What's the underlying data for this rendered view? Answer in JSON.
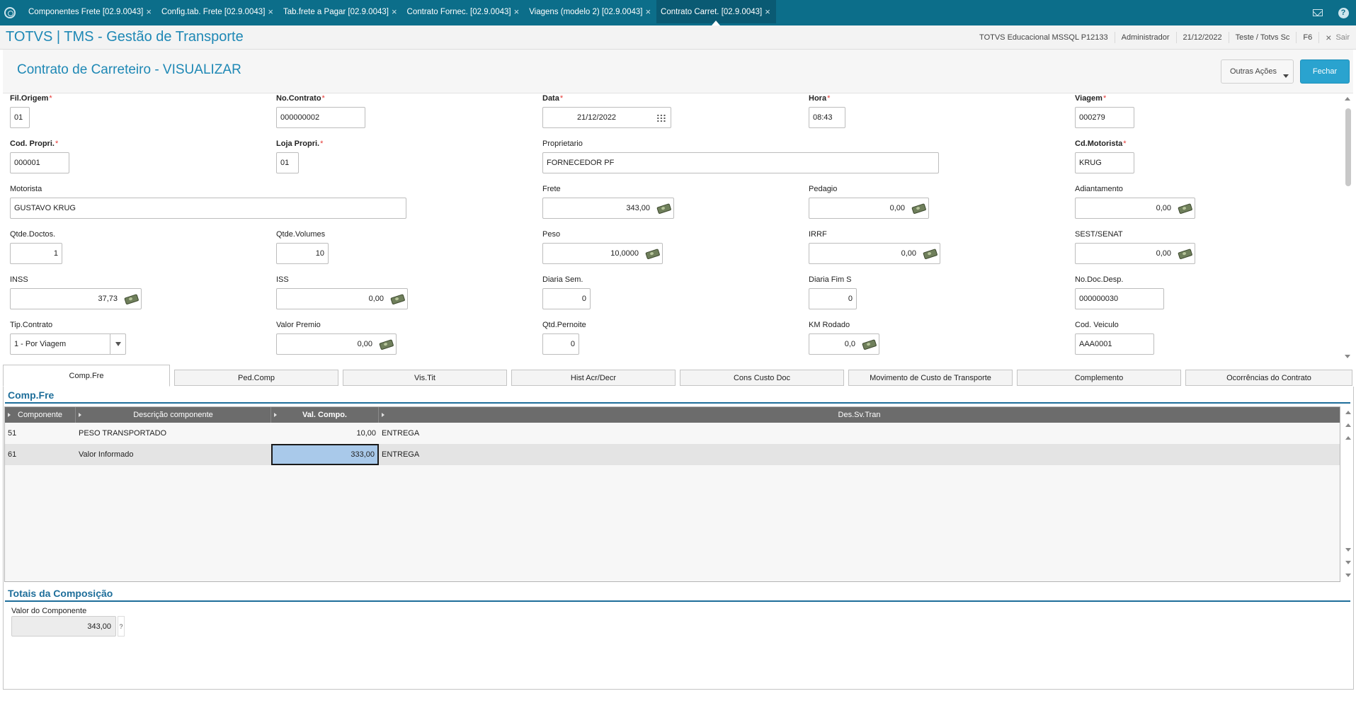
{
  "tabs": [
    {
      "label": "Componentes Frete [02.9.0043]",
      "close": "×",
      "active": false
    },
    {
      "label": "Config.tab. Frete [02.9.0043]",
      "close": "×",
      "active": false
    },
    {
      "label": "Tab.frete a Pagar [02.9.0043]",
      "close": "×",
      "active": false
    },
    {
      "label": "Contrato Fornec. [02.9.0043]",
      "close": "×",
      "active": false
    },
    {
      "label": "Viagens (modelo 2) [02.9.0043]",
      "close": "×",
      "active": false
    },
    {
      "label": "Contrato Carret. [02.9.0043]",
      "close": "×",
      "active": true
    }
  ],
  "header": {
    "app_title": "TOTVS | TMS - Gestão de Transporte",
    "environment": "TOTVS Educacional MSSQL P12133",
    "user": "Administrador",
    "date": "21/12/2022",
    "branch": "Teste / Totvs Sc",
    "shortcut": "F6",
    "exit_label": "Sair",
    "exit_icon": "×"
  },
  "page": {
    "title": "Contrato de Carreteiro - VISUALIZAR",
    "other_actions_label": "Outras Ações",
    "close_label": "Fechar"
  },
  "form": {
    "fil_origem": {
      "label": "Fil.Origem",
      "value": "01",
      "required": "*"
    },
    "no_contrato": {
      "label": "No.Contrato",
      "value": "000000002",
      "required": "*"
    },
    "data": {
      "label": "Data",
      "value": "21/12/2022",
      "required": "*"
    },
    "hora": {
      "label": "Hora",
      "value": "08:43",
      "required": "*"
    },
    "viagem": {
      "label": "Viagem",
      "value": "000279",
      "required": "*"
    },
    "cod_propri": {
      "label": "Cod. Propri.",
      "value": "000001",
      "required": "*"
    },
    "loja_propri": {
      "label": "Loja Propri.",
      "value": "01",
      "required": "*"
    },
    "proprietario": {
      "label": "Proprietario",
      "value": "FORNECEDOR PF"
    },
    "cd_motorista": {
      "label": "Cd.Motorista",
      "value": "KRUG",
      "required": "*"
    },
    "motorista": {
      "label": "Motorista",
      "value": "GUSTAVO KRUG"
    },
    "frete": {
      "label": "Frete",
      "value": "343,00"
    },
    "pedagio": {
      "label": "Pedagio",
      "value": "0,00"
    },
    "adiantamento": {
      "label": "Adiantamento",
      "value": "0,00"
    },
    "qtde_doctos": {
      "label": "Qtde.Doctos.",
      "value": "1"
    },
    "qtde_volumes": {
      "label": "Qtde.Volumes",
      "value": "10"
    },
    "peso": {
      "label": "Peso",
      "value": "10,0000"
    },
    "irrf": {
      "label": "IRRF",
      "value": "0,00"
    },
    "sest_senat": {
      "label": "SEST/SENAT",
      "value": "0,00"
    },
    "inss": {
      "label": "INSS",
      "value": "37,73"
    },
    "iss": {
      "label": "ISS",
      "value": "0,00"
    },
    "diaria_sem": {
      "label": "Diaria Sem.",
      "value": "0"
    },
    "diaria_fim_s": {
      "label": "Diaria Fim S",
      "value": "0"
    },
    "no_doc_desp": {
      "label": "No.Doc.Desp.",
      "value": "000000030"
    },
    "tip_contrato": {
      "label": "Tip.Contrato",
      "value": "1 - Por Viagem"
    },
    "valor_premio": {
      "label": "Valor Premio",
      "value": "0,00"
    },
    "qtd_pernoite": {
      "label": "Qtd.Pernoite",
      "value": "0"
    },
    "km_rodado": {
      "label": "KM Rodado",
      "value": "0,0"
    },
    "cod_veiculo": {
      "label": "Cod. Veiculo",
      "value": "AAA0001"
    }
  },
  "folders": [
    {
      "label": "Comp.Fre",
      "active": true
    },
    {
      "label": "Ped.Comp"
    },
    {
      "label": "Vis.Tit"
    },
    {
      "label": "Hist Acr/Decr"
    },
    {
      "label": "Cons Custo Doc"
    },
    {
      "label": "Movimento de Custo de Transporte"
    },
    {
      "label": "Complemento"
    },
    {
      "label": "Ocorrências do Contrato"
    }
  ],
  "comp_fre": {
    "section_title": "Comp.Fre",
    "columns": [
      "Componente",
      "Descrição componente",
      "Val. Compo.",
      "Des.Sv.Tran"
    ],
    "rows": [
      {
        "componente": "51",
        "descricao": "PESO TRANSPORTADO",
        "valor": "10,00",
        "servico": "ENTREGA"
      },
      {
        "componente": "61",
        "descricao": "Valor Informado",
        "valor": "333,00",
        "servico": "ENTREGA"
      }
    ]
  },
  "totals": {
    "section_title": "Totais da Composição",
    "label": "Valor do Componente",
    "value": "343,00",
    "help": "?"
  },
  "colors": {
    "topbar": "#0c6e8a",
    "accent": "#1e88b5",
    "primary_button": "#2aa3cf",
    "required": "#e53935",
    "grid_header": "#6c6c6c",
    "selected_cell": "#a9c9ea"
  }
}
